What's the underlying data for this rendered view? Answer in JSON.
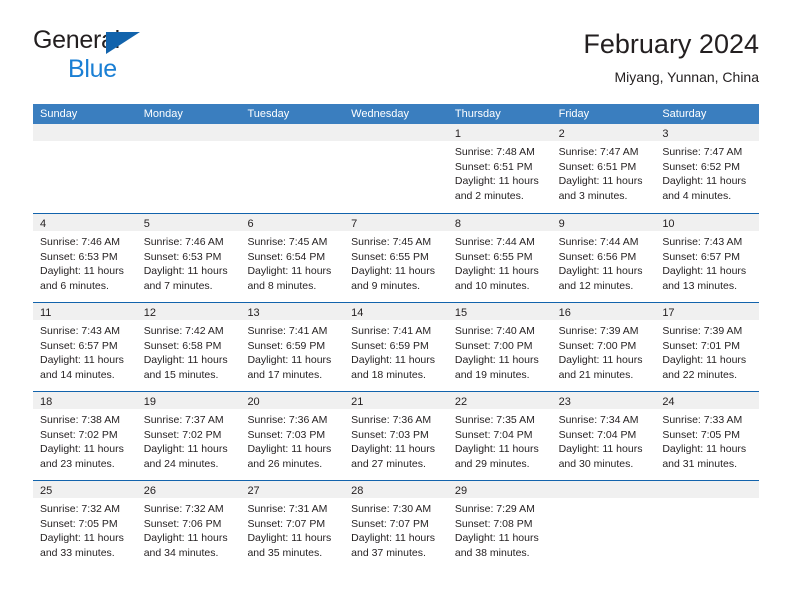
{
  "brand": {
    "line1": "General",
    "line2": "Blue",
    "logo_color": "#1263ac",
    "blue_text_color": "#1a7fd4"
  },
  "header": {
    "title": "February 2024",
    "subtitle": "Miyang, Yunnan, China"
  },
  "theme": {
    "header_row_bg": "#3a7ebf",
    "row_divider": "#1263ac",
    "day_band_bg": "#f0f0f0",
    "text": "#231f20"
  },
  "weekday_headers": [
    "Sunday",
    "Monday",
    "Tuesday",
    "Wednesday",
    "Thursday",
    "Friday",
    "Saturday"
  ],
  "weeks": [
    [
      {
        "day": "",
        "empty": true
      },
      {
        "day": "",
        "empty": true
      },
      {
        "day": "",
        "empty": true
      },
      {
        "day": "",
        "empty": true
      },
      {
        "day": "1",
        "sunrise": "Sunrise: 7:48 AM",
        "sunset": "Sunset: 6:51 PM",
        "daylight1": "Daylight: 11 hours",
        "daylight2": "and 2 minutes."
      },
      {
        "day": "2",
        "sunrise": "Sunrise: 7:47 AM",
        "sunset": "Sunset: 6:51 PM",
        "daylight1": "Daylight: 11 hours",
        "daylight2": "and 3 minutes."
      },
      {
        "day": "3",
        "sunrise": "Sunrise: 7:47 AM",
        "sunset": "Sunset: 6:52 PM",
        "daylight1": "Daylight: 11 hours",
        "daylight2": "and 4 minutes."
      }
    ],
    [
      {
        "day": "4",
        "sunrise": "Sunrise: 7:46 AM",
        "sunset": "Sunset: 6:53 PM",
        "daylight1": "Daylight: 11 hours",
        "daylight2": "and 6 minutes."
      },
      {
        "day": "5",
        "sunrise": "Sunrise: 7:46 AM",
        "sunset": "Sunset: 6:53 PM",
        "daylight1": "Daylight: 11 hours",
        "daylight2": "and 7 minutes."
      },
      {
        "day": "6",
        "sunrise": "Sunrise: 7:45 AM",
        "sunset": "Sunset: 6:54 PM",
        "daylight1": "Daylight: 11 hours",
        "daylight2": "and 8 minutes."
      },
      {
        "day": "7",
        "sunrise": "Sunrise: 7:45 AM",
        "sunset": "Sunset: 6:55 PM",
        "daylight1": "Daylight: 11 hours",
        "daylight2": "and 9 minutes."
      },
      {
        "day": "8",
        "sunrise": "Sunrise: 7:44 AM",
        "sunset": "Sunset: 6:55 PM",
        "daylight1": "Daylight: 11 hours",
        "daylight2": "and 10 minutes."
      },
      {
        "day": "9",
        "sunrise": "Sunrise: 7:44 AM",
        "sunset": "Sunset: 6:56 PM",
        "daylight1": "Daylight: 11 hours",
        "daylight2": "and 12 minutes."
      },
      {
        "day": "10",
        "sunrise": "Sunrise: 7:43 AM",
        "sunset": "Sunset: 6:57 PM",
        "daylight1": "Daylight: 11 hours",
        "daylight2": "and 13 minutes."
      }
    ],
    [
      {
        "day": "11",
        "sunrise": "Sunrise: 7:43 AM",
        "sunset": "Sunset: 6:57 PM",
        "daylight1": "Daylight: 11 hours",
        "daylight2": "and 14 minutes."
      },
      {
        "day": "12",
        "sunrise": "Sunrise: 7:42 AM",
        "sunset": "Sunset: 6:58 PM",
        "daylight1": "Daylight: 11 hours",
        "daylight2": "and 15 minutes."
      },
      {
        "day": "13",
        "sunrise": "Sunrise: 7:41 AM",
        "sunset": "Sunset: 6:59 PM",
        "daylight1": "Daylight: 11 hours",
        "daylight2": "and 17 minutes."
      },
      {
        "day": "14",
        "sunrise": "Sunrise: 7:41 AM",
        "sunset": "Sunset: 6:59 PM",
        "daylight1": "Daylight: 11 hours",
        "daylight2": "and 18 minutes."
      },
      {
        "day": "15",
        "sunrise": "Sunrise: 7:40 AM",
        "sunset": "Sunset: 7:00 PM",
        "daylight1": "Daylight: 11 hours",
        "daylight2": "and 19 minutes."
      },
      {
        "day": "16",
        "sunrise": "Sunrise: 7:39 AM",
        "sunset": "Sunset: 7:00 PM",
        "daylight1": "Daylight: 11 hours",
        "daylight2": "and 21 minutes."
      },
      {
        "day": "17",
        "sunrise": "Sunrise: 7:39 AM",
        "sunset": "Sunset: 7:01 PM",
        "daylight1": "Daylight: 11 hours",
        "daylight2": "and 22 minutes."
      }
    ],
    [
      {
        "day": "18",
        "sunrise": "Sunrise: 7:38 AM",
        "sunset": "Sunset: 7:02 PM",
        "daylight1": "Daylight: 11 hours",
        "daylight2": "and 23 minutes."
      },
      {
        "day": "19",
        "sunrise": "Sunrise: 7:37 AM",
        "sunset": "Sunset: 7:02 PM",
        "daylight1": "Daylight: 11 hours",
        "daylight2": "and 24 minutes."
      },
      {
        "day": "20",
        "sunrise": "Sunrise: 7:36 AM",
        "sunset": "Sunset: 7:03 PM",
        "daylight1": "Daylight: 11 hours",
        "daylight2": "and 26 minutes."
      },
      {
        "day": "21",
        "sunrise": "Sunrise: 7:36 AM",
        "sunset": "Sunset: 7:03 PM",
        "daylight1": "Daylight: 11 hours",
        "daylight2": "and 27 minutes."
      },
      {
        "day": "22",
        "sunrise": "Sunrise: 7:35 AM",
        "sunset": "Sunset: 7:04 PM",
        "daylight1": "Daylight: 11 hours",
        "daylight2": "and 29 minutes."
      },
      {
        "day": "23",
        "sunrise": "Sunrise: 7:34 AM",
        "sunset": "Sunset: 7:04 PM",
        "daylight1": "Daylight: 11 hours",
        "daylight2": "and 30 minutes."
      },
      {
        "day": "24",
        "sunrise": "Sunrise: 7:33 AM",
        "sunset": "Sunset: 7:05 PM",
        "daylight1": "Daylight: 11 hours",
        "daylight2": "and 31 minutes."
      }
    ],
    [
      {
        "day": "25",
        "sunrise": "Sunrise: 7:32 AM",
        "sunset": "Sunset: 7:05 PM",
        "daylight1": "Daylight: 11 hours",
        "daylight2": "and 33 minutes."
      },
      {
        "day": "26",
        "sunrise": "Sunrise: 7:32 AM",
        "sunset": "Sunset: 7:06 PM",
        "daylight1": "Daylight: 11 hours",
        "daylight2": "and 34 minutes."
      },
      {
        "day": "27",
        "sunrise": "Sunrise: 7:31 AM",
        "sunset": "Sunset: 7:07 PM",
        "daylight1": "Daylight: 11 hours",
        "daylight2": "and 35 minutes."
      },
      {
        "day": "28",
        "sunrise": "Sunrise: 7:30 AM",
        "sunset": "Sunset: 7:07 PM",
        "daylight1": "Daylight: 11 hours",
        "daylight2": "and 37 minutes."
      },
      {
        "day": "29",
        "sunrise": "Sunrise: 7:29 AM",
        "sunset": "Sunset: 7:08 PM",
        "daylight1": "Daylight: 11 hours",
        "daylight2": "and 38 minutes."
      },
      {
        "day": "",
        "empty": true
      },
      {
        "day": "",
        "empty": true
      }
    ]
  ]
}
